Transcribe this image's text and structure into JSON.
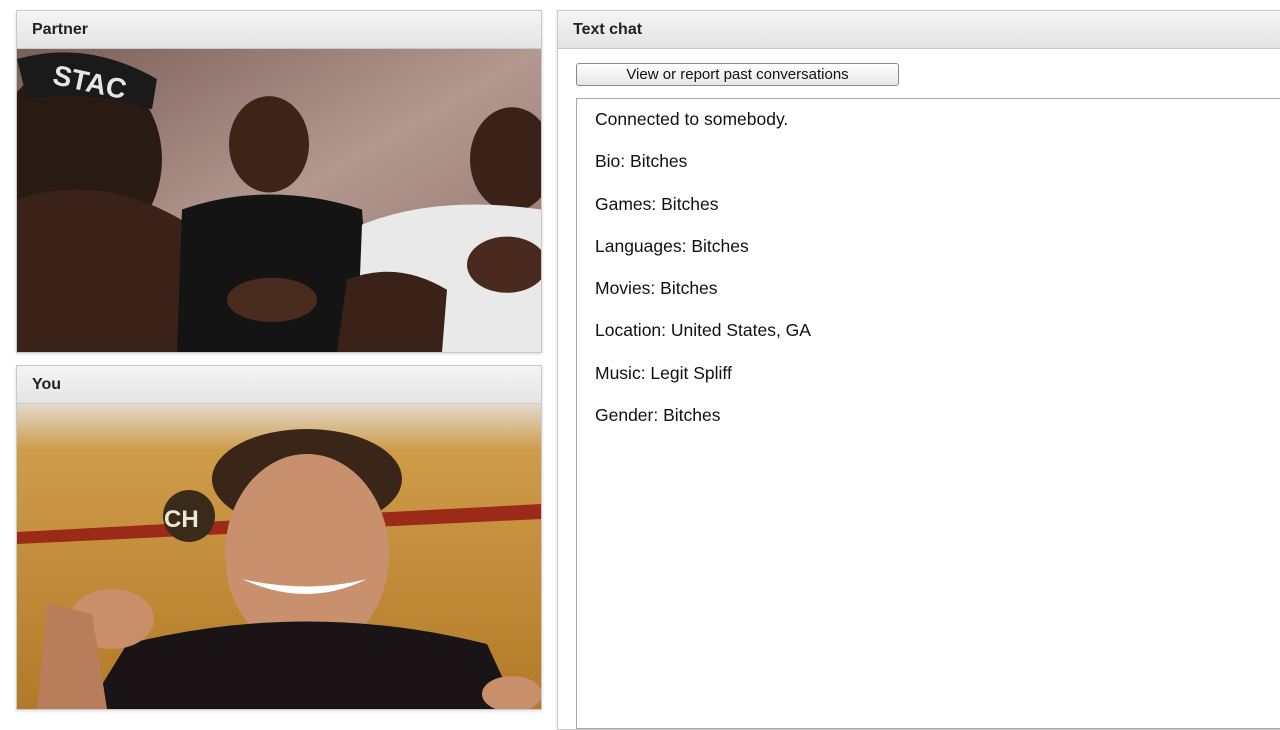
{
  "partner_panel": {
    "title": "Partner"
  },
  "you_panel": {
    "title": "You"
  },
  "chat_panel": {
    "title": "Text chat",
    "past_button_label": "View or report past conversations",
    "messages": [
      "Connected to somebody.",
      "Bio: Bitches",
      "Games: Bitches",
      "Languages: Bitches",
      "Movies: Bitches",
      "Location: United States, GA",
      "Music: Legit Spliff",
      "Gender: Bitches"
    ]
  },
  "partner_video": {
    "cap_text": "STAC"
  },
  "you_video": {
    "wall_logo_text": "CH"
  },
  "colors": {
    "header_bg": "#e9e9e9",
    "border": "#c9c9c9",
    "partner_wall": "#a88a80",
    "you_wall": "#c8902e"
  }
}
